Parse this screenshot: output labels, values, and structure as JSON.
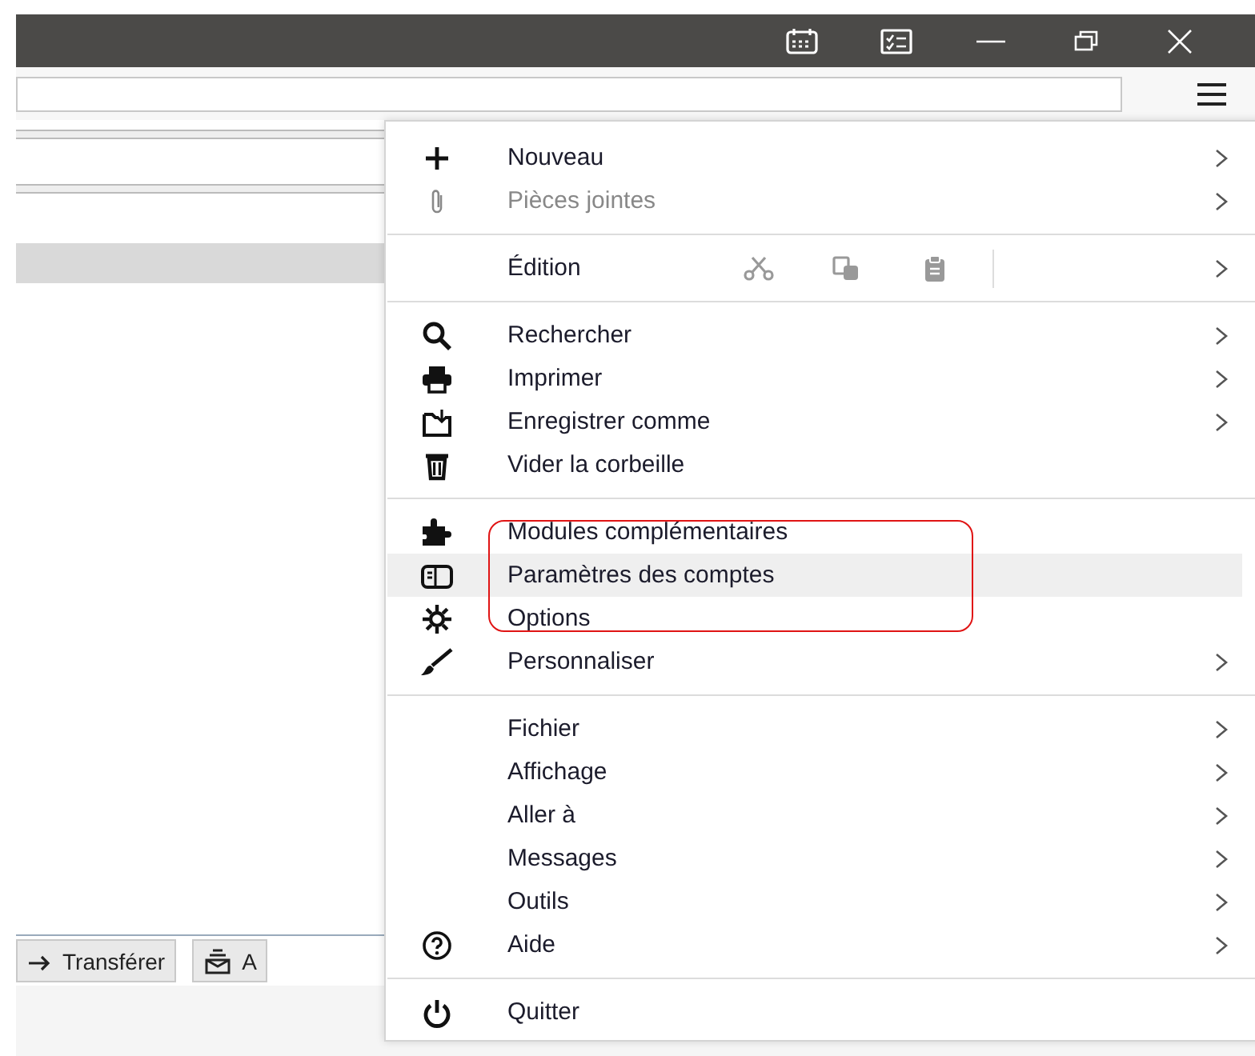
{
  "toolbar_buttons": [
    {
      "label": "Transférer"
    },
    {
      "label": "A"
    }
  ],
  "menu": {
    "sections": [
      [
        {
          "kind": "item",
          "label": "Nouveau",
          "submenu": true,
          "disabled": false,
          "highlighted": false
        },
        {
          "kind": "item",
          "label": "Pièces jointes",
          "submenu": true,
          "disabled": true,
          "highlighted": false
        }
      ],
      [
        {
          "kind": "edit",
          "label": "Édition",
          "submenu": true,
          "disabled": false,
          "highlighted": false
        }
      ],
      [
        {
          "kind": "item",
          "label": "Rechercher",
          "submenu": true,
          "disabled": false,
          "highlighted": false
        },
        {
          "kind": "item",
          "label": "Imprimer",
          "submenu": true,
          "disabled": false,
          "highlighted": false
        },
        {
          "kind": "item",
          "label": "Enregistrer comme",
          "submenu": true,
          "disabled": false,
          "highlighted": false
        },
        {
          "kind": "item",
          "label": "Vider la corbeille",
          "submenu": false,
          "disabled": false,
          "highlighted": false
        }
      ],
      [
        {
          "kind": "item",
          "label": "Modules complémentaires",
          "submenu": false,
          "disabled": false,
          "highlighted": false
        },
        {
          "kind": "item",
          "label": "Paramètres des comptes",
          "submenu": false,
          "disabled": false,
          "highlighted": true
        },
        {
          "kind": "item",
          "label": "Options",
          "submenu": false,
          "disabled": false,
          "highlighted": false
        },
        {
          "kind": "item",
          "label": "Personnaliser",
          "submenu": true,
          "disabled": false,
          "highlighted": false
        }
      ],
      [
        {
          "kind": "item",
          "label": "Fichier",
          "submenu": true,
          "disabled": false,
          "highlighted": false
        },
        {
          "kind": "item",
          "label": "Affichage",
          "submenu": true,
          "disabled": false,
          "highlighted": false
        },
        {
          "kind": "item",
          "label": "Aller à",
          "submenu": true,
          "disabled": false,
          "highlighted": false
        },
        {
          "kind": "item",
          "label": "Messages",
          "submenu": true,
          "disabled": false,
          "highlighted": false
        },
        {
          "kind": "item",
          "label": "Outils",
          "submenu": true,
          "disabled": false,
          "highlighted": false
        },
        {
          "kind": "item",
          "label": "Aide",
          "submenu": true,
          "disabled": false,
          "highlighted": false
        }
      ],
      [
        {
          "kind": "item",
          "label": "Quitter",
          "submenu": false,
          "disabled": false,
          "highlighted": false
        }
      ]
    ]
  }
}
